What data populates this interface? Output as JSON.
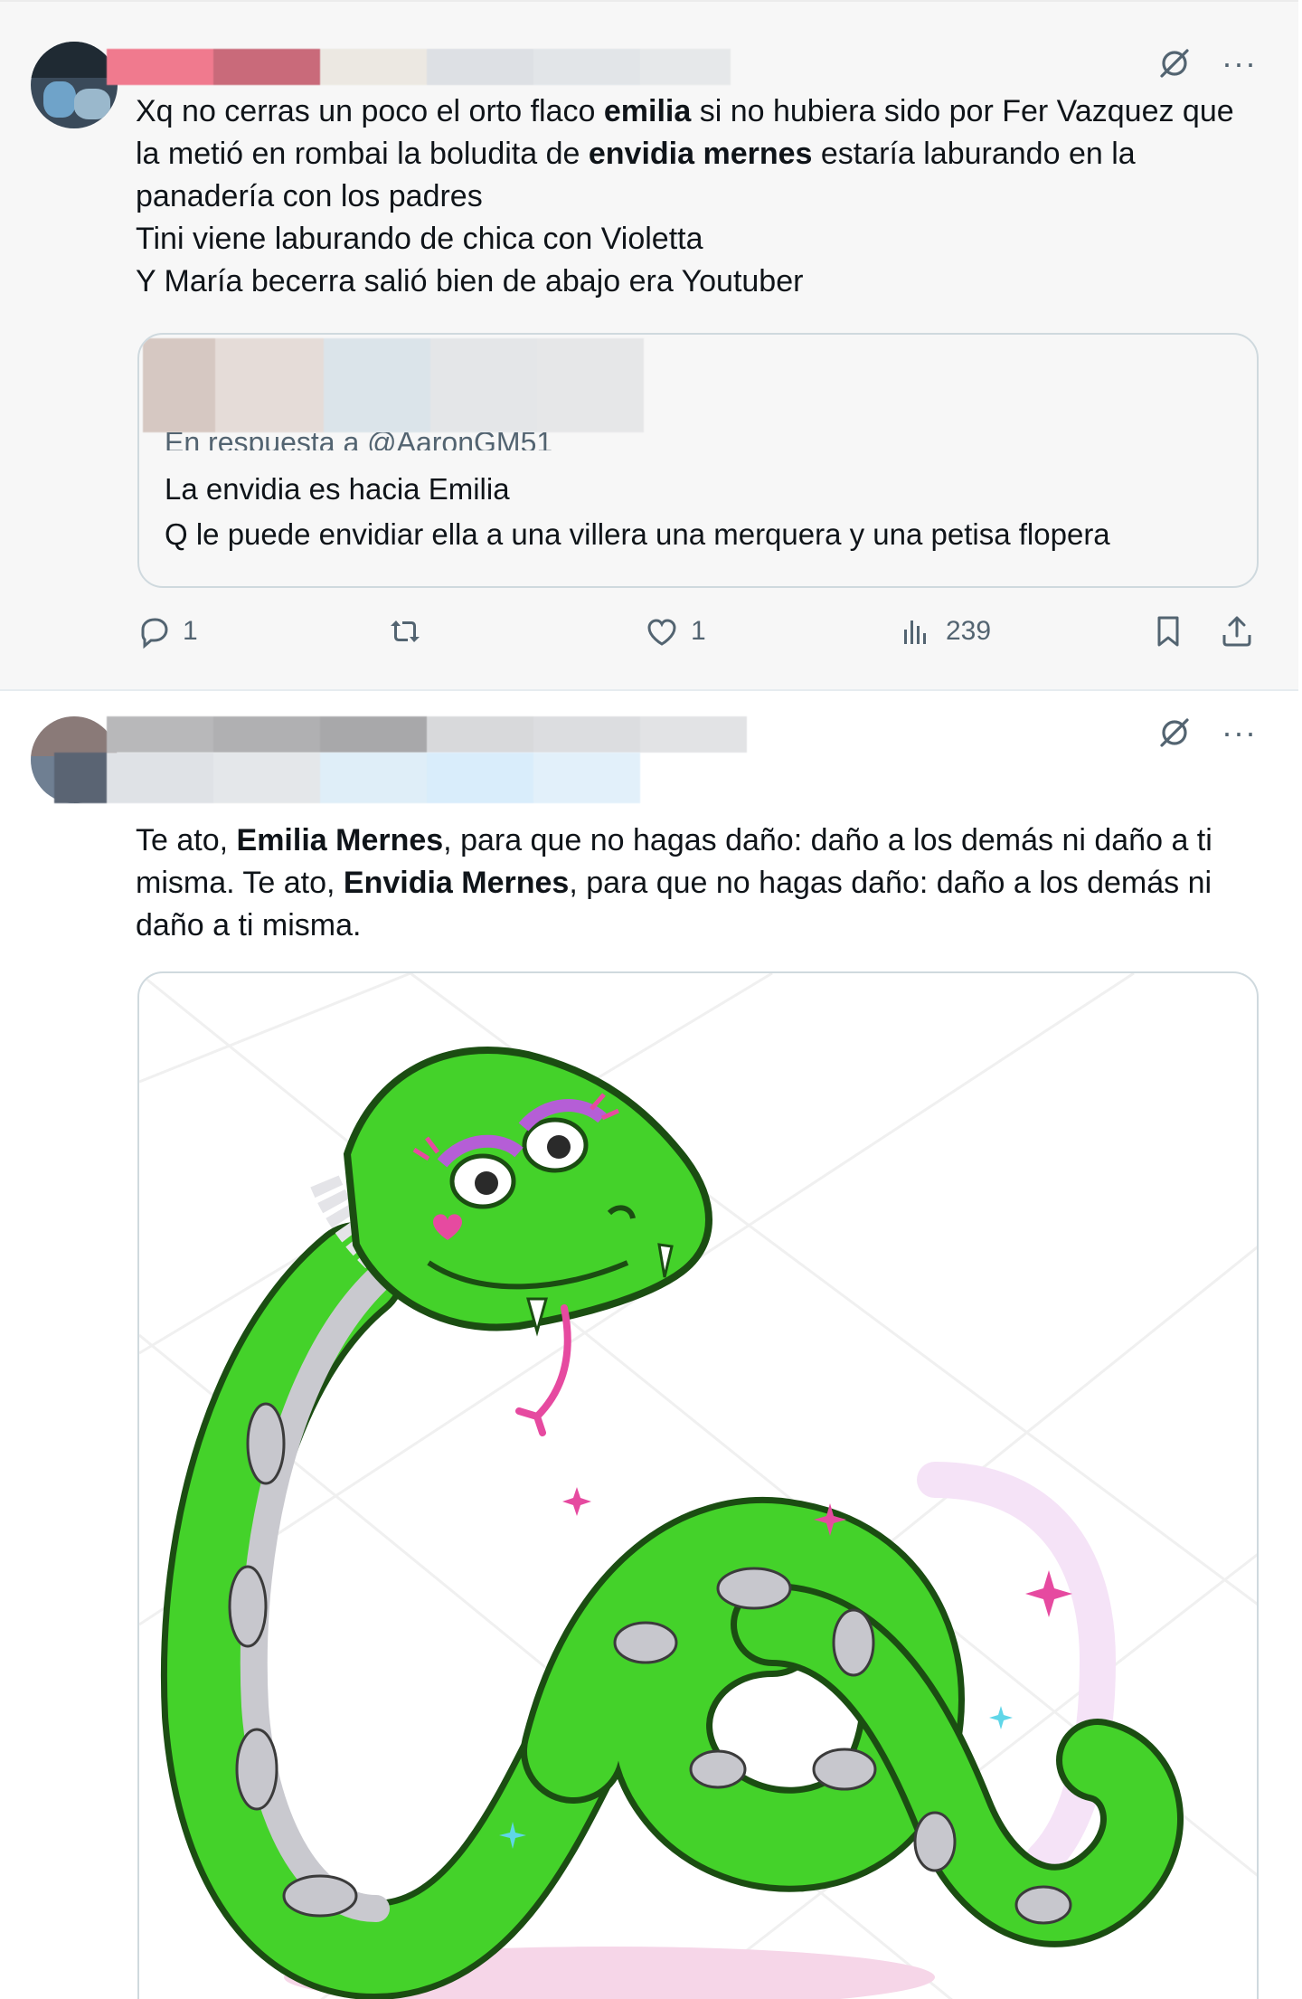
{
  "post1": {
    "more_label": "···",
    "text_segments": [
      {
        "t": "Xq no cerras un poco el orto flaco ",
        "b": false
      },
      {
        "t": "emilia",
        "b": true
      },
      {
        "t": " si no hubiera sido por Fer Vazquez que la metió en rombai la boludita de ",
        "b": false
      },
      {
        "t": "envidia mernes",
        "b": true
      },
      {
        "t": " estaría laburando en la panadería con los padres\nTini viene laburando de chica con Violetta\nY María becerra salió bien de abajo era Youtuber",
        "b": false
      }
    ],
    "quote": {
      "reply_to": "En respuesta a @AaronGM51",
      "text": "La envidia es hacia  Emilia\nQ le puede envidiar ella a una villera una merquera y una petisa flopera"
    },
    "actions": {
      "replies": "1",
      "reposts": "",
      "likes": "1",
      "views": "239"
    }
  },
  "post2": {
    "more_label": "···",
    "text_segments": [
      {
        "t": "Te ato, ",
        "b": false
      },
      {
        "t": "Emilia Mernes",
        "b": true
      },
      {
        "t": ", para que no hagas daño: daño a los demás ni daño a ti misma. Te ato, ",
        "b": false
      },
      {
        "t": "Envidia Mernes",
        "b": true
      },
      {
        "t": ", para que no hagas daño: daño a los demás ni daño a ti misma.",
        "b": false
      }
    ],
    "media": {
      "description_icon": "snake-illustration",
      "snake_color": "#43d12a",
      "accent_color": "#e64aa0"
    }
  },
  "colors": {
    "text": "#0f1419",
    "muted": "#536471",
    "border": "#cfd9de",
    "post1_bg": "#f7f7f7"
  }
}
